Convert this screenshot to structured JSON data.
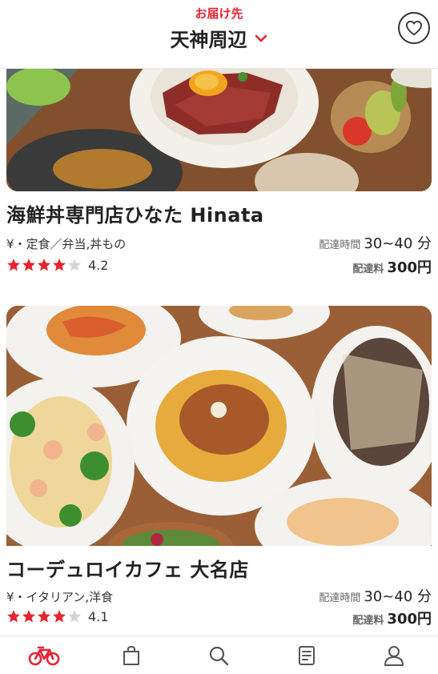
{
  "header": {
    "deliver_label": "お届け先",
    "location": "天神周辺",
    "favorite_icon": "heart-icon"
  },
  "colors": {
    "accent": "#e8232f",
    "star_filled": "#e8232f",
    "star_empty": "#d4d4d4"
  },
  "restaurants": [
    {
      "name": "海鮮丼専門店ひなた Hinata",
      "category": "¥・定食／弁当,丼もの",
      "delivery_time_label": "配達時間",
      "delivery_time": "30~40 分",
      "rating": "4.2",
      "rating_value": 4.2,
      "delivery_fee_label": "配達料",
      "delivery_fee": "300円"
    },
    {
      "name": "コーデュロイカフェ 大名店",
      "category": "¥・イタリアン,洋食",
      "delivery_time_label": "配達時間",
      "delivery_time": "30~40 分",
      "rating": "4.1",
      "rating_value": 4.1,
      "delivery_fee_label": "配達料",
      "delivery_fee": "300円"
    }
  ],
  "bottom_nav": {
    "items": [
      "bicycle-icon",
      "shopping-bag-icon",
      "search-icon",
      "receipt-icon",
      "user-icon"
    ],
    "active": "bicycle-icon"
  }
}
